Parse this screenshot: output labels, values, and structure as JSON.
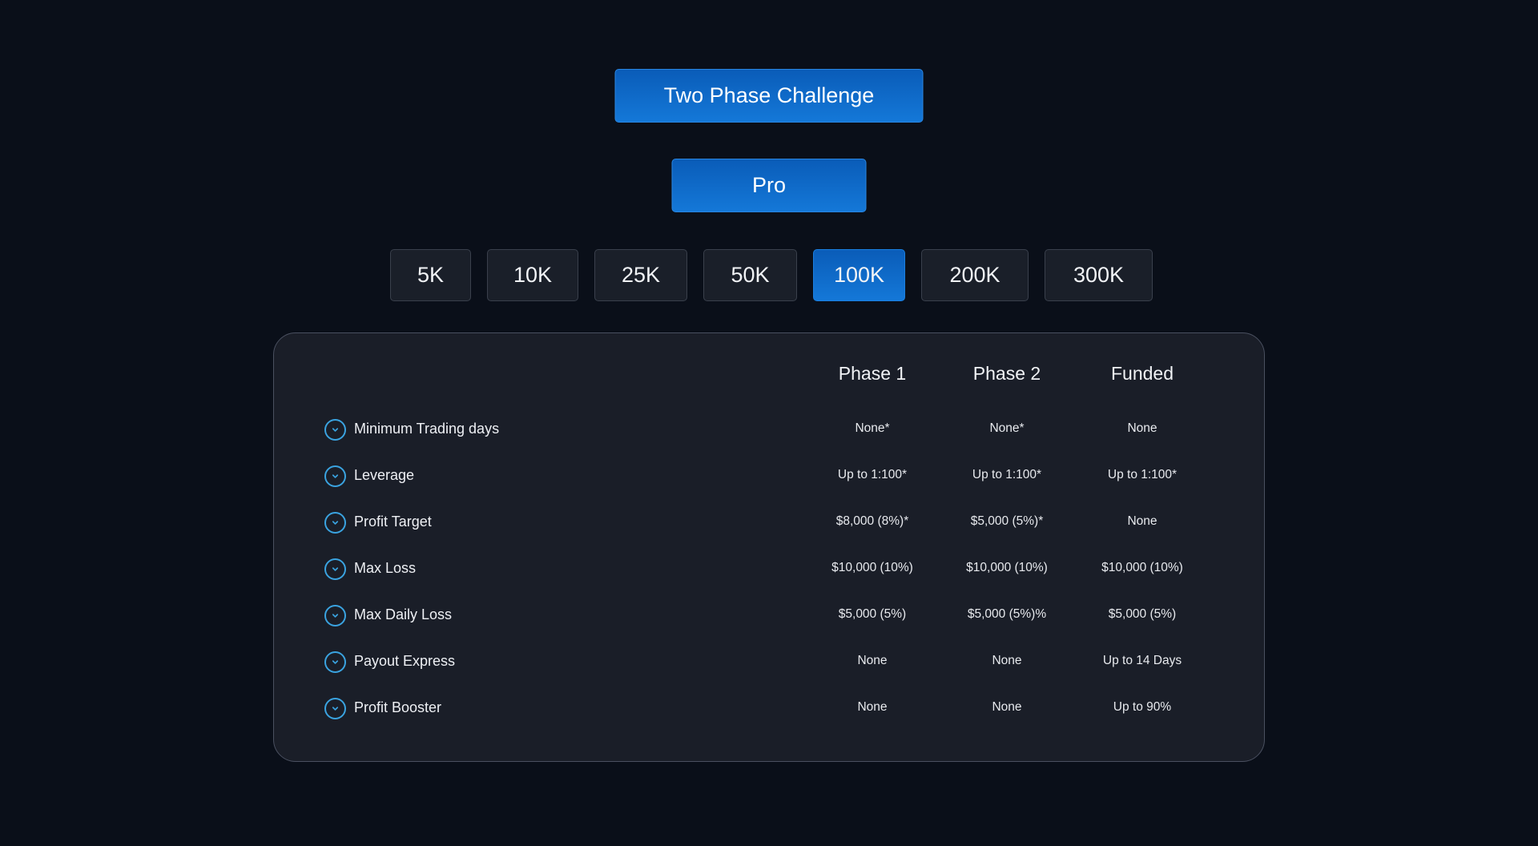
{
  "challenge_button": "Two Phase Challenge",
  "plan_button": "Pro",
  "account_sizes": [
    {
      "label": "5K",
      "active": false
    },
    {
      "label": "10K",
      "active": false
    },
    {
      "label": "25K",
      "active": false
    },
    {
      "label": "50K",
      "active": false
    },
    {
      "label": "100K",
      "active": true
    },
    {
      "label": "200K",
      "active": false
    },
    {
      "label": "300K",
      "active": false
    }
  ],
  "table": {
    "columns": [
      "Phase 1",
      "Phase 2",
      "Funded"
    ],
    "rows": [
      {
        "label": "Minimum Trading days",
        "values": [
          "None*",
          "None*",
          "None"
        ]
      },
      {
        "label": "Leverage",
        "values": [
          "Up to 1:100*",
          "Up to 1:100*",
          "Up to 1:100*"
        ]
      },
      {
        "label": "Profit Target",
        "values": [
          "$8,000 (8%)*",
          "$5,000 (5%)*",
          "None"
        ]
      },
      {
        "label": "Max Loss",
        "values": [
          "$10,000 (10%)",
          "$10,000 (10%)",
          "$10,000 (10%)"
        ]
      },
      {
        "label": "Max Daily Loss",
        "values": [
          "$5,000 (5%)",
          "$5,000 (5%)%",
          "$5,000 (5%)"
        ]
      },
      {
        "label": "Payout Express",
        "values": [
          "None",
          "None",
          "Up to 14 Days"
        ]
      },
      {
        "label": "Profit Booster",
        "values": [
          "None",
          "None",
          "Up to 90%"
        ]
      }
    ]
  },
  "icons": {
    "row_icon": "chevron-down-circle-icon"
  },
  "colors": {
    "accent": "#1478d8",
    "icon": "#3aa3e0",
    "background": "#0a0f19",
    "panel": "#1a1e28"
  }
}
